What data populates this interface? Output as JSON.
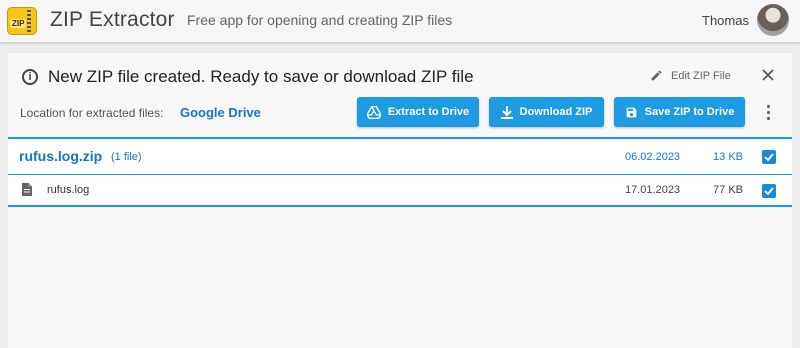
{
  "header": {
    "logo_text": "ZIP",
    "title": "ZIP Extractor",
    "subtitle": "Free app for opening and creating ZIP files",
    "user_name": "Thomas"
  },
  "notice": {
    "icon": "info-icon",
    "text": "New ZIP file created. Ready to save or download ZIP file",
    "edit_label": "Edit ZIP File",
    "close_icon": "close-icon"
  },
  "location": {
    "label": "Location for extracted files:",
    "value": "Google Drive"
  },
  "actions": {
    "extract_label": "Extract to Drive",
    "download_label": "Download ZIP",
    "save_label": "Save ZIP to Drive"
  },
  "archive": {
    "name": "rufus.log.zip",
    "count": "(1 file)",
    "date": "06.02.2023",
    "size": "13 KB",
    "checked": true
  },
  "files": [
    {
      "name": "rufus.log",
      "date": "17.01.2023",
      "size": "77 KB",
      "checked": true
    }
  ],
  "colors": {
    "accent": "#1e9be4",
    "link": "#1a73c8",
    "logo": "#f5c518"
  }
}
